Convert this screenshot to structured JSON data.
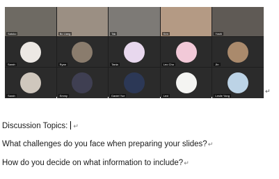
{
  "meeting": {
    "tiles": [
      {
        "name": "Satoko",
        "color": "#6e6a63"
      },
      {
        "name": "Bo Liang",
        "color": "#9b8f83"
      },
      {
        "name": "Tak",
        "color": "#7d7a76"
      },
      {
        "name": "Ken",
        "color": "#b49a84"
      },
      {
        "name": "Yoshi",
        "color": "#5f5a55"
      },
      {
        "name": "Sarah",
        "color": "#ece8e4"
      },
      {
        "name": "Ryan",
        "color": "#8a7c6d"
      },
      {
        "name": "Tania",
        "color": "#e8d8ee"
      },
      {
        "name": "Leo Cho",
        "color": "#f2c9d8"
      },
      {
        "name": "Jin",
        "color": "#aa8a6c"
      },
      {
        "name": "Sarah",
        "color": "#cfc7bd"
      },
      {
        "name": "Emmy",
        "color": "#3f3f52"
      },
      {
        "name": "Daniel Yue",
        "color": "#2c3856"
      },
      {
        "name": "Lexi",
        "color": "#f4f4f2"
      },
      {
        "name": "Leslie Yang",
        "color": "#bcd3e6"
      }
    ]
  },
  "doc": {
    "line1": "Discussion Topics:",
    "line2": "What challenges do you face when preparing your slides?",
    "line3": "How do you decide on what information to include?",
    "mark": "↵"
  }
}
